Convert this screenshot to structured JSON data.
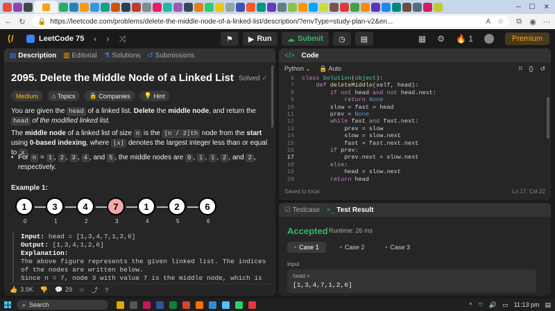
{
  "browser": {
    "url": "https://leetcode.com/problems/delete-the-middle-node-of-a-linked-list/description/?envType=study-plan-v2&en...",
    "tab_colors": [
      "#e74c3c",
      "#8e44ad",
      "#444",
      "#27ae60",
      "#2980b9",
      "#f39c12",
      "#3498db",
      "#16a085",
      "#d35400",
      "#2c3e50",
      "#c0392b",
      "#7f8c8d",
      "#e91e63",
      "#1abc9c",
      "#9b59b6",
      "#34495e",
      "#e67e22",
      "#2ecc71",
      "#f1c40f",
      "#95a5a6",
      "#3f51b5",
      "#ff5722",
      "#009688",
      "#673ab7",
      "#607d8b",
      "#8bc34a",
      "#ff9800",
      "#03a9f4",
      "#cddc39",
      "#795548",
      "#e53935",
      "#43a047",
      "#fb8c00",
      "#5e35b1",
      "#1e88e5",
      "#00897b",
      "#6d4c41",
      "#546e7a",
      "#d81b60",
      "#c0ca33"
    ]
  },
  "topbar": {
    "plan": "LeetCode 75",
    "run": "Run",
    "submit": "Submit",
    "streak": "1",
    "premium": "Premium"
  },
  "desc_tabs": [
    "Description",
    "Editorial",
    "Solutions",
    "Submissions"
  ],
  "problem": {
    "title": "2095. Delete the Middle Node of a Linked List",
    "solved": "Solved",
    "chips": [
      "Medium",
      "Topics",
      "Companies",
      "Hint"
    ],
    "p1_a": "You are given the ",
    "p1_head": "head",
    "p1_b": " of a linked list. ",
    "p1_c": "Delete",
    "p1_d": " the ",
    "p1_e": "middle node",
    "p1_f": ", and return the ",
    "p1_g": "head",
    "p1_h": " of the modified linked list.",
    "p2_a": "The ",
    "p2_b": "middle node",
    "p2_c": " of a linked list of size ",
    "p2_n": "n",
    "p2_d": " is the ",
    "p2_e": "⌊n / 2⌋th",
    "p2_f": " node from the ",
    "p2_g": "start",
    "p2_h": " using ",
    "p2_i": "0-based indexing",
    "p2_j": ", where ",
    "p2_k": "⌊x⌋",
    "p2_l": " denotes the largest integer less than or equal to ",
    "p2_m": "x",
    "p2_o": ".",
    "bullet_a": "For ",
    "bullet_n": "n",
    "bullet_b": " = ",
    "bullet_vals": [
      "1",
      "2",
      "3",
      "4"
    ],
    "bullet_c": ", and ",
    "bullet_v5": "5",
    "bullet_d": ", the middle nodes are ",
    "bullet_mids": [
      "0",
      "1",
      "1",
      "2"
    ],
    "bullet_e": ", and ",
    "bullet_m5": "2",
    "bullet_f": ", respectively.",
    "example_title": "Example 1:",
    "nodes": [
      "1",
      "3",
      "4",
      "7",
      "1",
      "2",
      "6"
    ],
    "indices": [
      "0",
      "1",
      "2",
      "3",
      "4",
      "5",
      "6"
    ],
    "input_label": "Input:",
    "input_value": "head = [1,3,4,7,1,2,6]",
    "output_label": "Output:",
    "output_value": "[1,3,4,1,2,6]",
    "explanation_label": "Explanation:",
    "explanation_text": "The above figure represents the given linked list. The indices of the nodes are written below.",
    "explanation_more": "Since n = 7, node 3 with value 7 is the middle node, which is marked in"
  },
  "footer": {
    "likes": "3.9K",
    "comments": "29"
  },
  "code": {
    "title": "Code",
    "language": "Python",
    "auto": "Auto",
    "lines": [
      {
        "n": "6",
        "t": "class Solution(object):"
      },
      {
        "n": "7",
        "t": "    def deleteMiddle(self, head):"
      },
      {
        "n": "8",
        "t": "        if not head and not head.next:"
      },
      {
        "n": "9",
        "t": "            return None"
      },
      {
        "n": "10",
        "t": "        slow = fast = head"
      },
      {
        "n": "11",
        "t": "        prev = None"
      },
      {
        "n": "12",
        "t": "        while fast and fast.next:"
      },
      {
        "n": "13",
        "t": "            prev = slow"
      },
      {
        "n": "14",
        "t": "            slow = slow.next"
      },
      {
        "n": "15",
        "t": "            fast = fast.next.next"
      },
      {
        "n": "16",
        "t": "        if prev:"
      },
      {
        "n": "17",
        "t": "            prev.next = slow.next"
      },
      {
        "n": "18",
        "t": "        else:"
      },
      {
        "n": "19",
        "t": "            head = slow.next"
      },
      {
        "n": "20",
        "t": "        return head"
      }
    ],
    "saved": "Saved to local",
    "position": "Ln 17, Col 22"
  },
  "result": {
    "tab1": "Testcase",
    "tab2": "Test Result",
    "status": "Accepted",
    "runtime": "Runtime: 26 ms",
    "cases": [
      "Case 1",
      "Case 2",
      "Case 3"
    ],
    "input_label": "Input",
    "var": "head =",
    "value": "[1,3,4,7,1,2,6]"
  },
  "taskbar": {
    "search": "Search",
    "time": "11:13 pm",
    "icon_colors": [
      "#e0a800",
      "#555",
      "#c2185b",
      "#2b579a",
      "#107c41",
      "#d24726",
      "#ff6f00",
      "#2f8cdc",
      "#4cc2ff",
      "#25d366",
      "#e53935"
    ]
  }
}
